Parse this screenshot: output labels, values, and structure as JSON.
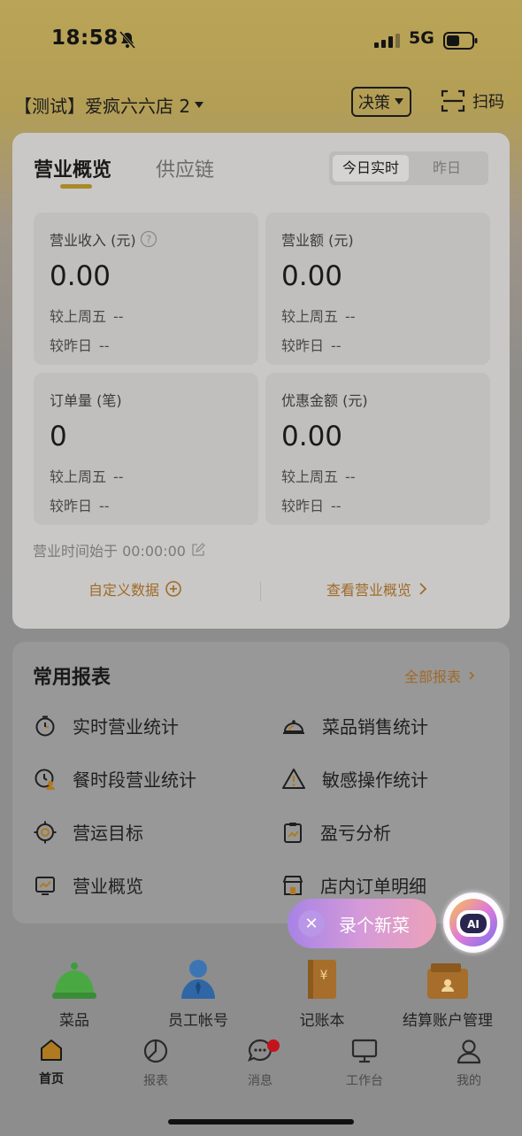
{
  "status": {
    "time": "18:58",
    "network": "5G"
  },
  "header": {
    "store_name": "【测试】爱疯六六店 2",
    "decision_label": "决策",
    "scan_label": "扫码"
  },
  "overview": {
    "tabs": [
      "营业概览",
      "供应链"
    ],
    "period_options": [
      "今日实时",
      "昨日"
    ],
    "metrics": [
      {
        "title": "营业收入 (元)",
        "value": "0.00",
        "compare1": "较上周五",
        "compare1_val": "--",
        "compare2": "较昨日",
        "compare2_val": "--"
      },
      {
        "title": "营业额 (元)",
        "value": "0.00",
        "compare1": "较上周五",
        "compare1_val": "--",
        "compare2": "较昨日",
        "compare2_val": "--"
      },
      {
        "title": "订单量 (笔)",
        "value": "0",
        "compare1": "较上周五",
        "compare1_val": "--",
        "compare2": "较昨日",
        "compare2_val": "--"
      },
      {
        "title": "优惠金额 (元)",
        "value": "0.00",
        "compare1": "较上周五",
        "compare1_val": "--",
        "compare2": "较昨日",
        "compare2_val": "--"
      }
    ],
    "business_start": "营业时间始于 00:00:00",
    "custom_data": "自定义数据",
    "view_overview": "查看营业概览"
  },
  "reports": {
    "title": "常用报表",
    "all_label": "全部报表",
    "items": [
      {
        "label": "实时营业统计",
        "icon": "timer-icon"
      },
      {
        "label": "菜品销售统计",
        "icon": "dish-cover-icon"
      },
      {
        "label": "餐时段营业统计",
        "icon": "clock-user-icon"
      },
      {
        "label": "敏感操作统计",
        "icon": "warning-icon"
      },
      {
        "label": "营运目标",
        "icon": "target-icon"
      },
      {
        "label": "盈亏分析",
        "icon": "clipboard-chart-icon"
      },
      {
        "label": "营业概览",
        "icon": "monitor-chart-icon"
      },
      {
        "label": "店内订单明细",
        "icon": "store-icon"
      }
    ]
  },
  "quick": [
    {
      "label": "菜品",
      "icon": "dish-cover-icon"
    },
    {
      "label": "员工帐号",
      "icon": "person-icon"
    },
    {
      "label": "记账本",
      "icon": "ledger-icon"
    },
    {
      "label": "结算账户管理",
      "icon": "wallet-icon"
    }
  ],
  "floating": {
    "record_label": "录个新菜"
  },
  "tabbar": [
    {
      "label": "首页"
    },
    {
      "label": "报表"
    },
    {
      "label": "消息"
    },
    {
      "label": "工作台"
    },
    {
      "label": "我的"
    }
  ]
}
